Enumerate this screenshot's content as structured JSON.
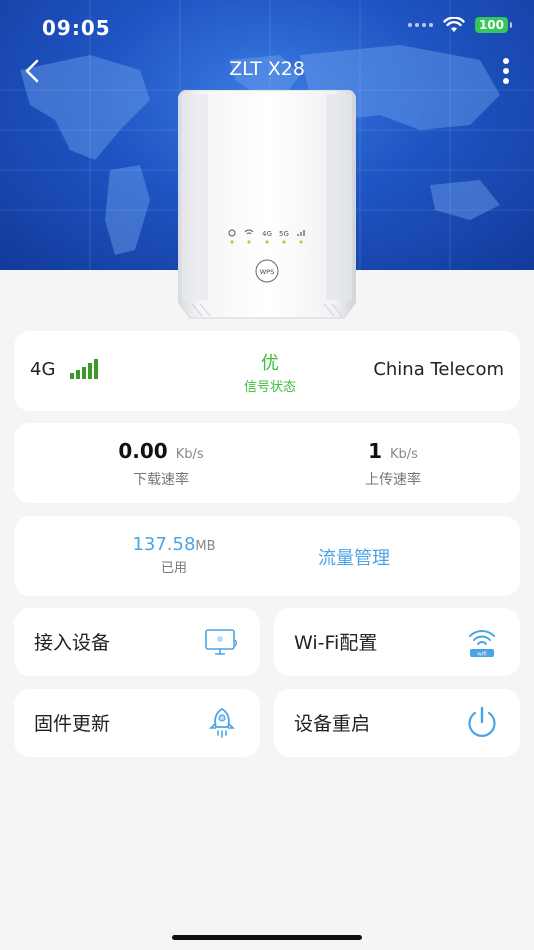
{
  "status_bar": {
    "time": "09:05",
    "battery": "100"
  },
  "header": {
    "title": "ZLT X28"
  },
  "device": {
    "indicator_labels": [
      "4G",
      "5G"
    ],
    "wps_label": "WPS"
  },
  "signal_card": {
    "network_type": "4G",
    "quality": "优",
    "quality_label": "信号状态",
    "carrier": "China Telecom",
    "signal_bars": 5
  },
  "speed_card": {
    "download_value": "0.00",
    "download_unit": "Kb/s",
    "download_label": "下载速率",
    "upload_value": "1",
    "upload_unit": "Kb/s",
    "upload_label": "上传速率"
  },
  "usage_card": {
    "used_value": "137.58",
    "used_unit": "MB",
    "used_label": "已用",
    "manage_label": "流量管理"
  },
  "tiles": {
    "devices": "接入设备",
    "wifi": "Wi-Fi配置",
    "wifi_icon_text": "wifi",
    "firmware": "固件更新",
    "reboot": "设备重启"
  },
  "colors": {
    "accent": "#4ba4e6",
    "signal_good": "#3bbf3b",
    "header_blue": "#1f55c4",
    "battery_green": "#34c759"
  }
}
